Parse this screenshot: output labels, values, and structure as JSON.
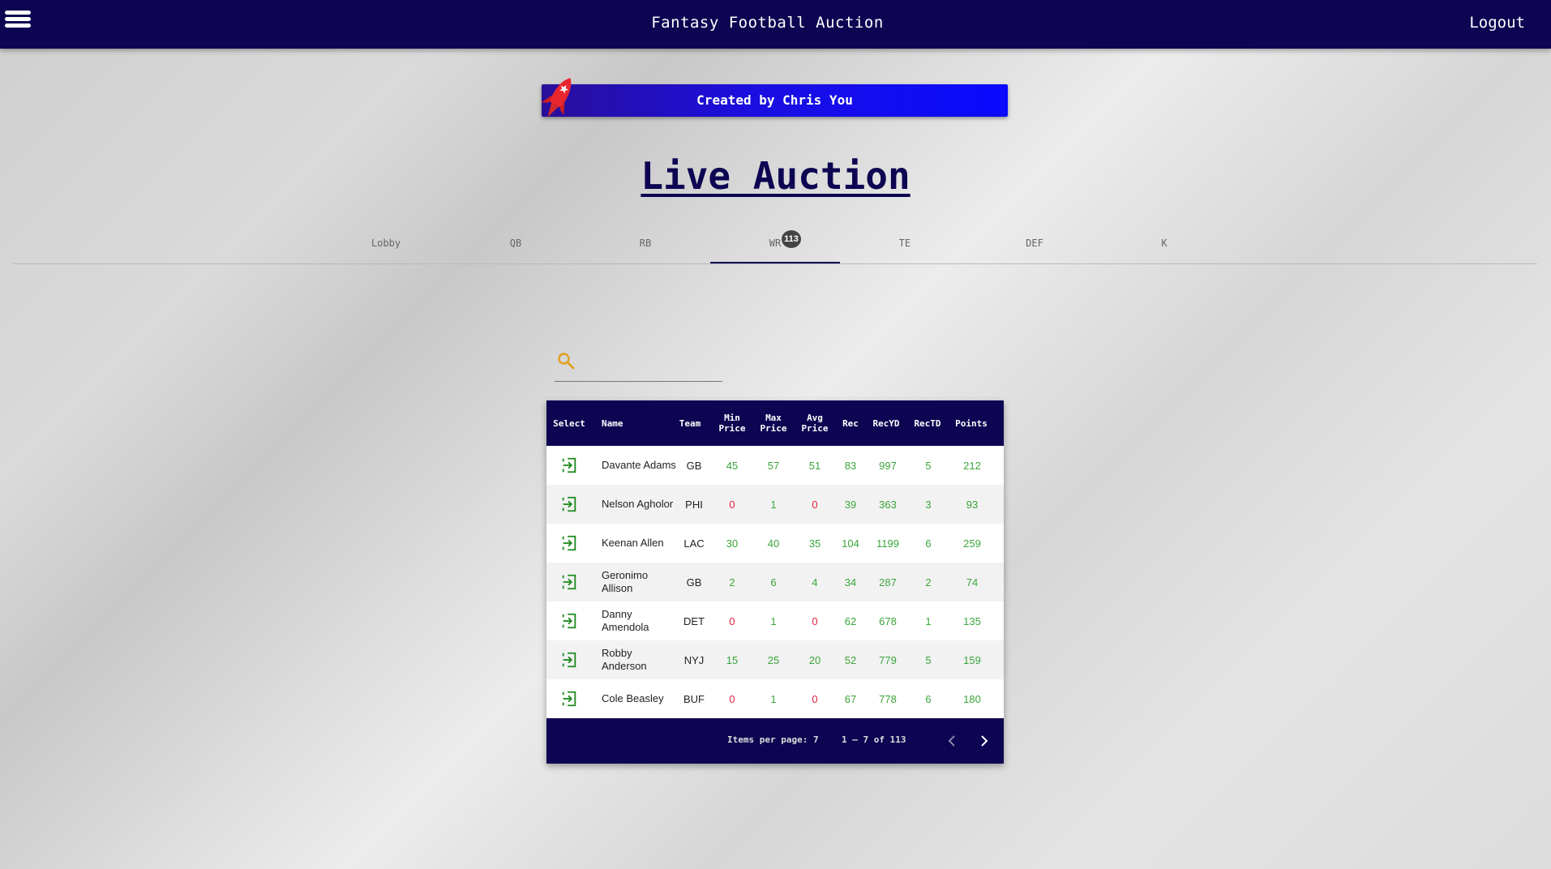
{
  "header": {
    "app_title": "Fantasy Football Auction",
    "logout_label": "Logout"
  },
  "banner": {
    "text": "Created by Chris You"
  },
  "page": {
    "heading": "Live Auction"
  },
  "tabs": [
    {
      "label": "Lobby"
    },
    {
      "label": "QB"
    },
    {
      "label": "RB"
    },
    {
      "label": "WR",
      "badge": "113",
      "active": true
    },
    {
      "label": "TE"
    },
    {
      "label": "DEF"
    },
    {
      "label": "K"
    }
  ],
  "search": {
    "value": "",
    "placeholder": ""
  },
  "table": {
    "columns": {
      "select": "Select",
      "name": "Name",
      "team": "Team",
      "min_price_1": "Min",
      "min_price_2": "Price",
      "max_price_1": "Max",
      "max_price_2": "Price",
      "avg_price_1": "Avg",
      "avg_price_2": "Price",
      "rec": "Rec",
      "recyd": "RecYD",
      "rectd": "RecTD",
      "points": "Points"
    },
    "rows": [
      {
        "name_1": "Davante Adams",
        "name_2": "",
        "team": "GB",
        "min": "45",
        "max": "57",
        "avg": "51",
        "rec": "83",
        "recyd": "997",
        "rectd": "5",
        "points": "212"
      },
      {
        "name_1": "Nelson Agholor",
        "name_2": "",
        "team": "PHI",
        "min": "0",
        "max": "1",
        "avg": "0",
        "rec": "39",
        "recyd": "363",
        "rectd": "3",
        "points": "93"
      },
      {
        "name_1": "Keenan Allen",
        "name_2": "",
        "team": "LAC",
        "min": "30",
        "max": "40",
        "avg": "35",
        "rec": "104",
        "recyd": "1199",
        "rectd": "6",
        "points": "259"
      },
      {
        "name_1": "Geronimo",
        "name_2": "Allison",
        "team": "GB",
        "min": "2",
        "max": "6",
        "avg": "4",
        "rec": "34",
        "recyd": "287",
        "rectd": "2",
        "points": "74"
      },
      {
        "name_1": "Danny",
        "name_2": "Amendola",
        "team": "DET",
        "min": "0",
        "max": "1",
        "avg": "0",
        "rec": "62",
        "recyd": "678",
        "rectd": "1",
        "points": "135"
      },
      {
        "name_1": "Robby",
        "name_2": "Anderson",
        "team": "NYJ",
        "min": "15",
        "max": "25",
        "avg": "20",
        "rec": "52",
        "recyd": "779",
        "rectd": "5",
        "points": "159"
      },
      {
        "name_1": "Cole Beasley",
        "name_2": "",
        "team": "BUF",
        "min": "0",
        "max": "1",
        "avg": "0",
        "rec": "67",
        "recyd": "778",
        "rectd": "6",
        "points": "180"
      }
    ]
  },
  "paginator": {
    "items_per_page": "Items per page: 7",
    "range": "1 – 7 of 113"
  },
  "colors": {
    "navy": "#0d0552",
    "value_green": "#3aa53a",
    "value_red": "#e0203a",
    "search_accent": "#e0a020",
    "banner_blue": "#0a0aff"
  },
  "icons": {
    "menu": "hamburger-icon",
    "rocket": "rocket-icon",
    "search": "search-icon",
    "select": "enter-arrow-icon",
    "prev": "chevron-left-icon",
    "next": "chevron-right-icon"
  }
}
